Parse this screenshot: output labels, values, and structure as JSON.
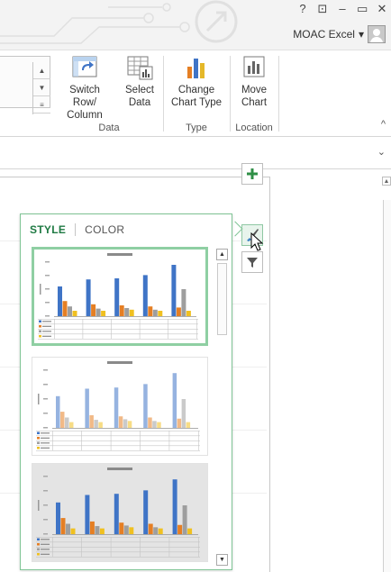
{
  "window": {
    "controls": [
      "?",
      "⊡",
      "–",
      "▭",
      "✕"
    ],
    "account_name": "MOAC Excel",
    "account_caret": "▾"
  },
  "ribbon": {
    "groups": [
      {
        "label": "Data",
        "buttons": [
          {
            "label_line1": "Switch Row/",
            "label_line2": "Column",
            "icon": "switch-row-column-icon"
          },
          {
            "label_line1": "Select",
            "label_line2": "Data",
            "icon": "select-data-icon"
          }
        ]
      },
      {
        "label": "Type",
        "buttons": [
          {
            "label_line1": "Change",
            "label_line2": "Chart Type",
            "icon": "change-chart-type-icon"
          }
        ]
      },
      {
        "label": "Location",
        "buttons": [
          {
            "label_line1": "Move",
            "label_line2": "Chart",
            "icon": "move-chart-icon"
          }
        ]
      }
    ],
    "collapse_caret": "^"
  },
  "formula_bar": {
    "expand_caret": "⌄"
  },
  "side_buttons": [
    {
      "name": "chart-elements",
      "glyph": "+",
      "color": "#2f8f46"
    },
    {
      "name": "chart-styles",
      "glyph": "brush",
      "color": "#3a7fc1"
    },
    {
      "name": "chart-filters",
      "glyph": "funnel",
      "color": "#555555"
    }
  ],
  "flyout": {
    "tabs": [
      {
        "label": "STYLE",
        "active": true
      },
      {
        "label": "COLOR",
        "active": false
      }
    ],
    "scroll_up": "▲",
    "scroll_down": "▼",
    "styles": [
      {
        "name": "Style 1",
        "selected": true,
        "dark": false
      },
      {
        "name": "Style 2",
        "selected": false,
        "dark": false
      },
      {
        "name": "Style 3",
        "selected": false,
        "dark": true
      }
    ]
  },
  "colors": {
    "accent_green": "#7fc495",
    "series_blue": "#3f74c6",
    "series_orange": "#e57f24",
    "series_gray": "#9e9e9e",
    "series_yellow": "#f0c020"
  }
}
